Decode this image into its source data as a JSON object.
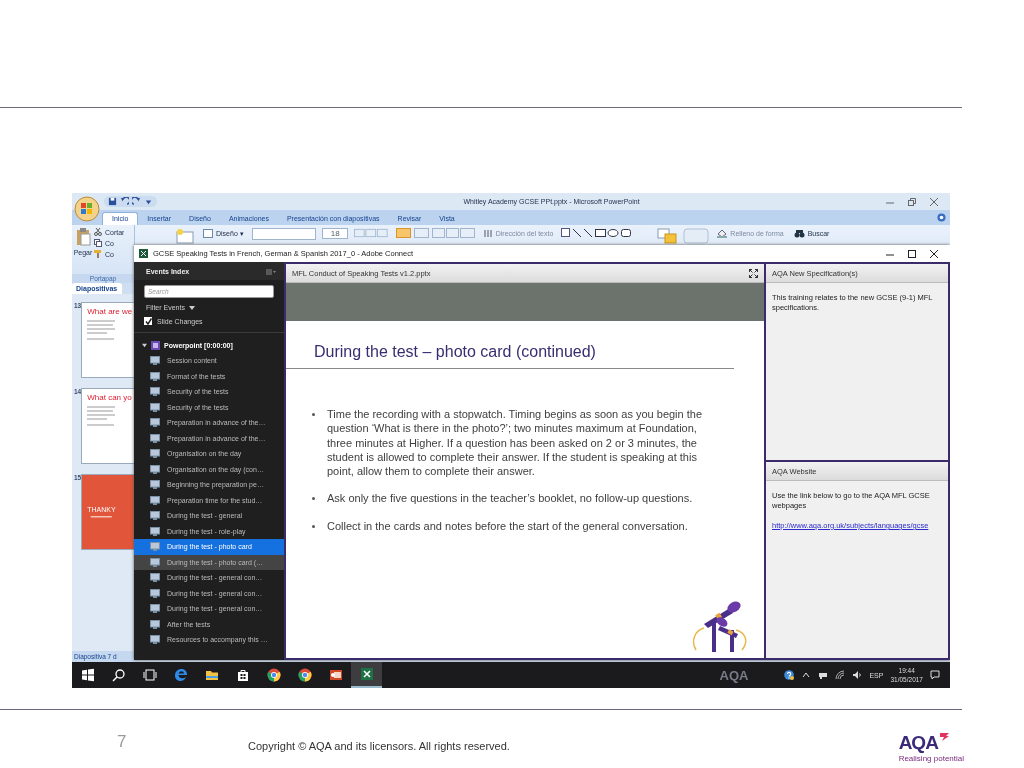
{
  "powerpoint": {
    "title": "Whitley Academy GCSE PPt.pptx - Microsoft PowerPoint",
    "tabs": [
      {
        "label": "Inicio",
        "selected": true
      },
      {
        "label": "Insertar",
        "selected": false
      },
      {
        "label": "Diseño",
        "selected": false
      },
      {
        "label": "Animaciones",
        "selected": false
      },
      {
        "label": "Presentación con diapositivas",
        "selected": false
      },
      {
        "label": "Revisar",
        "selected": false
      },
      {
        "label": "Vista",
        "selected": false
      }
    ],
    "ribbon": {
      "paste": "Pegar",
      "cut": "Cortar",
      "copy": "Co",
      "format_painter": "Co",
      "group": "Portapap",
      "layout": "Diseño ▾",
      "font_size": "18",
      "text_direction": "Dirección del texto",
      "shape_fill": "Relleno de forma",
      "find": "Buscar"
    },
    "slides_tab": "Diapositivas",
    "thumbnails": [
      {
        "number": "13",
        "title": "What are we",
        "kind": "text"
      },
      {
        "number": "14",
        "title": "What can yo",
        "kind": "text"
      },
      {
        "number": "15",
        "title": "THANKY",
        "kind": "thanks"
      }
    ],
    "status": "Diapositiva 7 d"
  },
  "connect": {
    "title": "GCSE Speaking Tests in French, German & Spanish 2017_0 - Adobe Connect",
    "events": {
      "title": "Events Index",
      "search_placeholder": "Search",
      "filter": "Filter Events",
      "slide_changes": {
        "label": "Slide Changes",
        "checked": true
      },
      "root": {
        "label": "Powerpoint [0:00:00]",
        "expanded": true,
        "children": [
          {
            "label": "Session content",
            "selected": false,
            "hovered": false
          },
          {
            "label": "Format of the tests",
            "selected": false,
            "hovered": false
          },
          {
            "label": "Security of the tests",
            "selected": false,
            "hovered": false
          },
          {
            "label": "Security of the tests",
            "selected": false,
            "hovered": false
          },
          {
            "label": "Preparation in advance of the…",
            "selected": false,
            "hovered": false
          },
          {
            "label": "Preparation in advance of the…",
            "selected": false,
            "hovered": false
          },
          {
            "label": "Organisation on the day",
            "selected": false,
            "hovered": false
          },
          {
            "label": "Organisation on the day (con…",
            "selected": false,
            "hovered": false
          },
          {
            "label": "Beginning the preparation pe…",
            "selected": false,
            "hovered": false
          },
          {
            "label": "Preparation time for the stud…",
            "selected": false,
            "hovered": false
          },
          {
            "label": "During the test - general",
            "selected": false,
            "hovered": false
          },
          {
            "label": "During the test - role-play",
            "selected": false,
            "hovered": false
          },
          {
            "label": "During the test - photo card",
            "selected": true,
            "hovered": false
          },
          {
            "label": "During the test - photo card (…",
            "selected": false,
            "hovered": true
          },
          {
            "label": "During the test - general con…",
            "selected": false,
            "hovered": false
          },
          {
            "label": "During the test - general con…",
            "selected": false,
            "hovered": false
          },
          {
            "label": "During the test - general con…",
            "selected": false,
            "hovered": false
          },
          {
            "label": "After the tests",
            "selected": false,
            "hovered": false
          },
          {
            "label": "Resources to accompany this …",
            "selected": false,
            "hovered": false
          }
        ]
      }
    },
    "share": {
      "title": "MFL Conduct of Speaking Tests v1.2.pptx",
      "slide_title": "During the test – photo card (continued)",
      "bullets": [
        "Time the recording with a stopwatch. Timing begins as soon as you begin the question ‘What is there in the photo?’; two minutes maximum at Foundation, three minutes at Higher. If a question has been asked on 2 or 3 minutes, the student is allowed to complete their answer. If the student is speaking at this point, allow them to complete their answer.",
        "Ask only the five questions in the teacher’s booklet, no follow-up questions.",
        "Collect in the cards and notes before the start of the general conversation."
      ]
    },
    "pods": [
      {
        "title": "AQA New Specification(s)",
        "text": "This training relates to the new GCSE (9-1) MFL specifications."
      },
      {
        "title": "AQA Website",
        "text": "Use the link below to go to the AQA MFL GCSE webpages",
        "link": "http://www.aqa.org.uk/subjects/languages/gcse"
      }
    ]
  },
  "taskbar": {
    "apps": [
      {
        "kind": "start",
        "active": false
      },
      {
        "kind": "search",
        "active": false
      },
      {
        "kind": "taskview",
        "active": false
      },
      {
        "kind": "edge",
        "active": false
      },
      {
        "kind": "explorer",
        "active": false
      },
      {
        "kind": "store",
        "active": false
      },
      {
        "kind": "chrome",
        "active": false
      },
      {
        "kind": "chrome",
        "active": false
      },
      {
        "kind": "powerpoint",
        "active": false
      },
      {
        "kind": "excel",
        "active": true
      }
    ],
    "behind_logo": "AQA",
    "language": "ESP",
    "time": "19:44",
    "date": "31/05/2017"
  },
  "slide": {
    "number": "7",
    "footer": "Copyright © AQA and its licensors. All rights reserved.",
    "logo": "AQA",
    "tagline": "Realising potential"
  }
}
